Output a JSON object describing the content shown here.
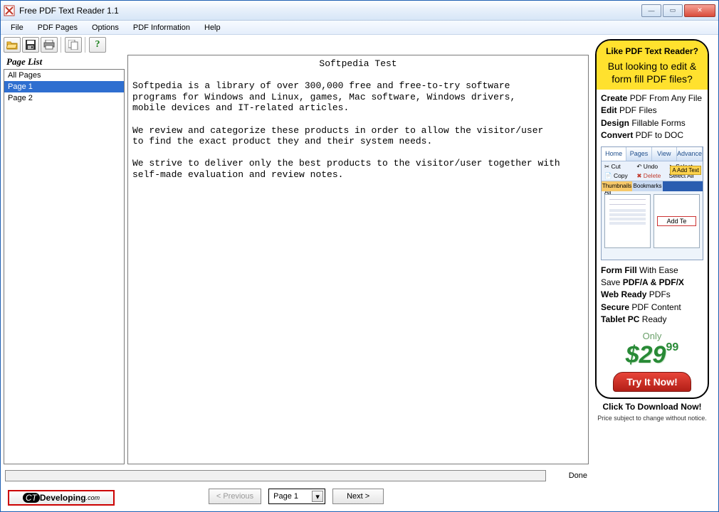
{
  "window": {
    "title": "Free PDF Text Reader 1.1"
  },
  "menu": {
    "items": [
      "File",
      "PDF Pages",
      "Options",
      "PDF Information",
      "Help"
    ]
  },
  "toolbar": {
    "buttons": [
      {
        "name": "open-icon"
      },
      {
        "name": "save-icon"
      },
      {
        "name": "print-icon"
      },
      {
        "name": "copy-icon"
      },
      {
        "name": "help-icon"
      }
    ]
  },
  "page_list": {
    "title": "Page List",
    "items": [
      "All Pages",
      "Page 1",
      "Page 2"
    ],
    "selected_index": 1
  },
  "document": {
    "title": "Softpedia Test",
    "body": "Softpedia is a library of over 300,000 free and free-to-try software\nprograms for Windows and Linux, games, Mac software, Windows drivers,\nmobile devices and IT-related articles.\n\nWe review and categorize these products in order to allow the visitor/user\nto find the exact product they and their system needs.\n\nWe strive to deliver only the best products to the visitor/user together with\nself-made evaluation and review notes."
  },
  "status": {
    "text": "Done"
  },
  "nav": {
    "previous_label": "< Previous",
    "next_label": "Next >",
    "page_select_value": "Page 1"
  },
  "logo": {
    "prefix": "CT",
    "suffix": "Developing",
    "tld": ".com"
  },
  "ad": {
    "headline1": "Like PDF Text Reader?",
    "headline2": "But looking to edit & form fill PDF files?",
    "features1": [
      {
        "b": "Create",
        "rest": " PDF From Any File"
      },
      {
        "b": "Edit",
        "rest": " PDF Files"
      },
      {
        "b": "Design",
        "rest": " Fillable Forms"
      },
      {
        "b": "Convert",
        "rest": " PDF to DOC"
      }
    ],
    "shot": {
      "tabs": [
        "Home",
        "Pages",
        "View",
        "Advance"
      ],
      "row2": [
        "✂ Cut",
        "↶ Undo",
        "➤ Select"
      ],
      "row2b": [
        "📄 Copy",
        "✖ Delete",
        "A Add Text"
      ],
      "row2c": [
        "Select All",
        "Unselect All",
        ""
      ],
      "thumbs": [
        "Thumbnails",
        "Bookmarks"
      ],
      "addtext": "Add Te"
    },
    "features2": [
      {
        "b": "Form Fill",
        "rest": " With Ease"
      },
      {
        "pre": "Save ",
        "b": "PDF/A & PDF/X",
        "rest": ""
      },
      {
        "b": "Web Ready",
        "rest": " PDFs"
      },
      {
        "b": "Secure",
        "rest": " PDF Content"
      },
      {
        "b": "Tablet PC",
        "rest": " Ready"
      }
    ],
    "price": {
      "only": "Only",
      "amount": "$29",
      "cents": "99"
    },
    "try_label": "Try It Now!",
    "download_label": "Click To Download Now!",
    "notice": "Price subject to change without notice."
  }
}
